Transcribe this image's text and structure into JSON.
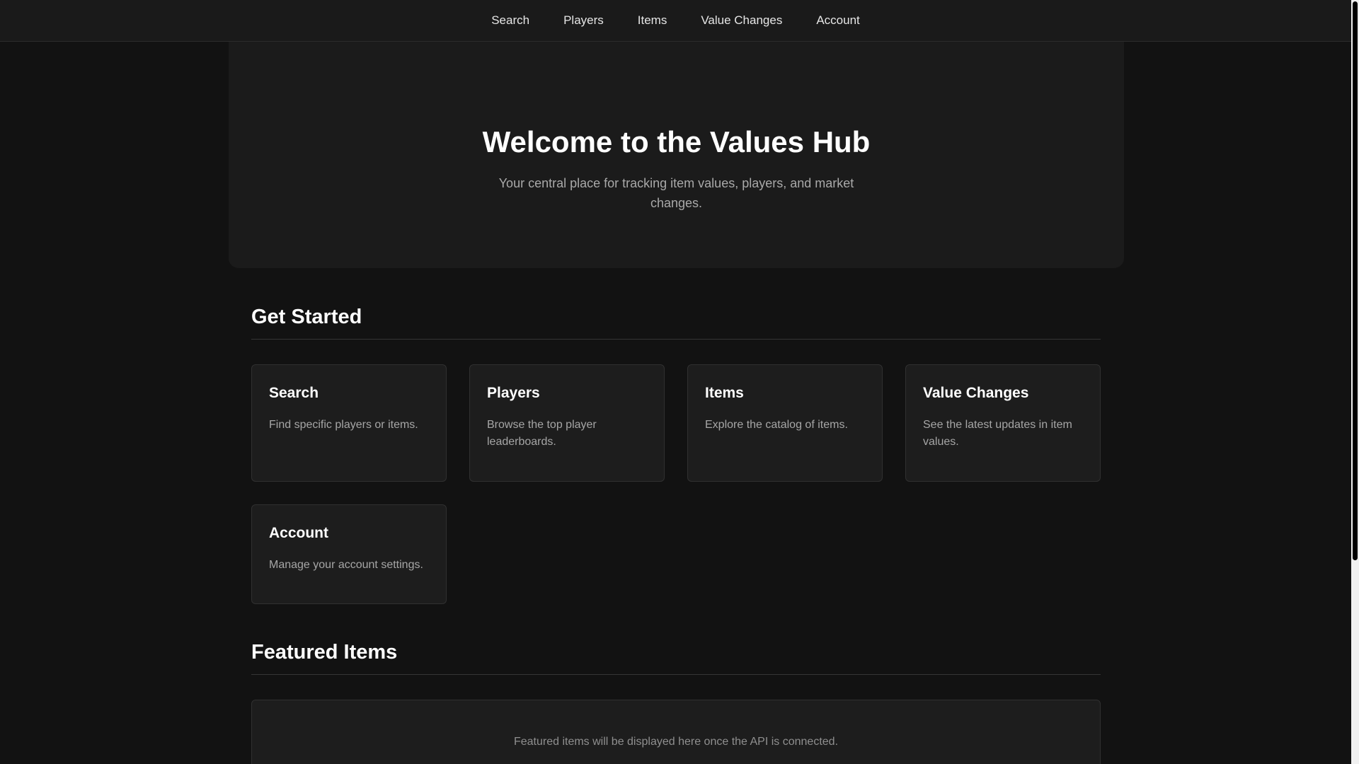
{
  "nav": {
    "links": [
      "Search",
      "Players",
      "Items",
      "Value Changes",
      "Account"
    ]
  },
  "hero": {
    "title": "Welcome to the Values Hub",
    "subtitle": "Your central place for tracking item values, players, and market changes."
  },
  "get_started": {
    "title": "Get Started",
    "cards": [
      {
        "title": "Search",
        "description": "Find specific players or items."
      },
      {
        "title": "Players",
        "description": "Browse the top player leaderboards."
      },
      {
        "title": "Items",
        "description": "Explore the catalog of items."
      },
      {
        "title": "Value Changes",
        "description": "See the latest updates in item values."
      },
      {
        "title": "Account",
        "description": "Manage your account settings."
      }
    ]
  },
  "featured": {
    "title": "Featured Items",
    "placeholder": "Featured items will be displayed here once the API is connected."
  },
  "colors": {
    "background": "#121212",
    "surface": "#1d1d1d",
    "text_primary": "#ffffff",
    "text_muted": "#a6a6a6"
  }
}
